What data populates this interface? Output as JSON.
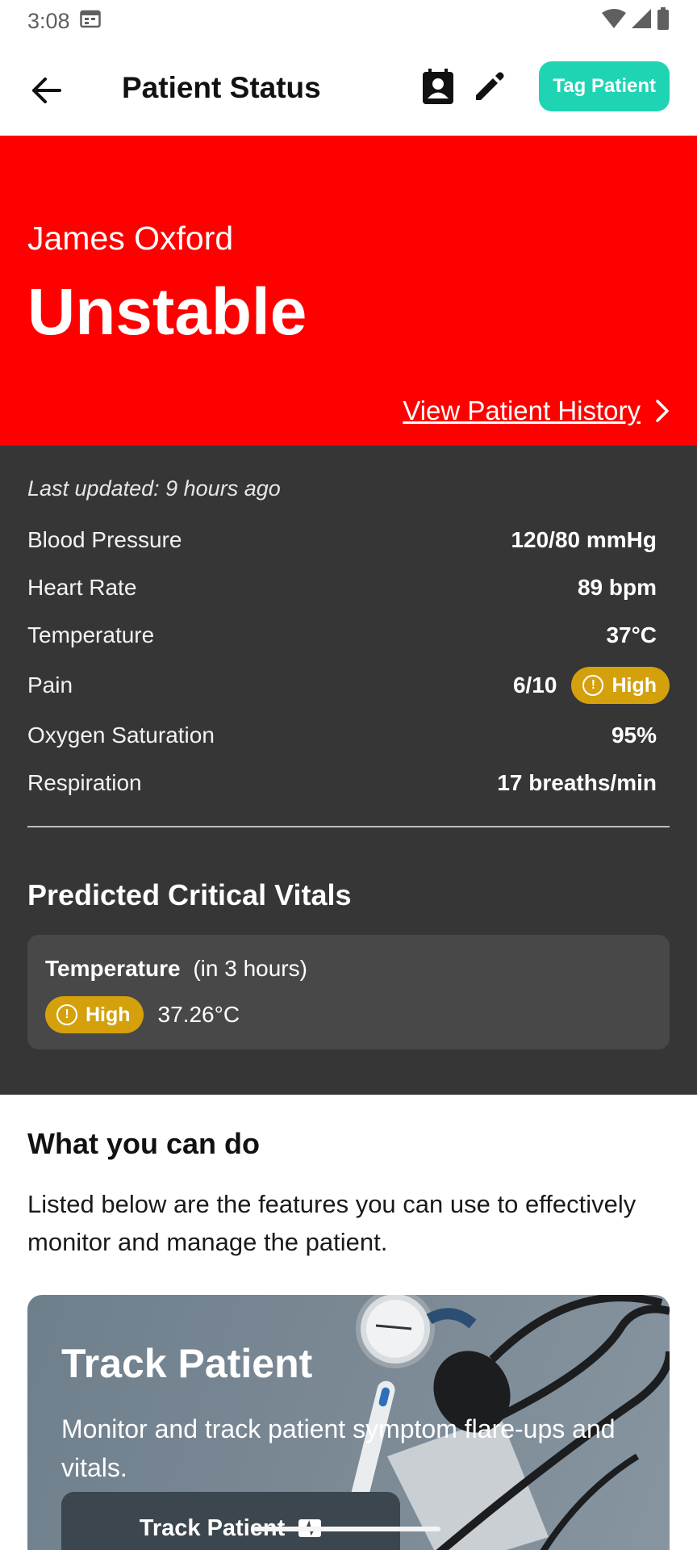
{
  "status_bar": {
    "time": "3:08"
  },
  "app_bar": {
    "title": "Patient Status",
    "tag_button": "Tag Patient"
  },
  "hero": {
    "patient_name": "James Oxford",
    "status": "Unstable",
    "history_link": "View Patient History",
    "background_color": "#ff0000"
  },
  "vitals": {
    "last_updated": "Last updated: 9 hours ago",
    "rows": [
      {
        "label": "Blood Pressure",
        "value": "120/80 mmHg"
      },
      {
        "label": "Heart Rate",
        "value": "89 bpm"
      },
      {
        "label": "Temperature",
        "value": "37°C"
      },
      {
        "label": "Pain",
        "value": "6/10",
        "badge": "High"
      },
      {
        "label": "Oxygen Saturation",
        "value": "95%"
      },
      {
        "label": "Respiration",
        "value": "17 breaths/min"
      }
    ]
  },
  "predicted": {
    "title": "Predicted Critical Vitals",
    "items": [
      {
        "vital": "Temperature",
        "timeframe": "(in 3 hours)",
        "badge": "High",
        "value": "37.26°C"
      }
    ]
  },
  "what_you_can_do": {
    "title": "What you can do",
    "description": "Listed below are the features you can use to effectively monitor and manage the patient."
  },
  "track_card": {
    "title": "Track Patient",
    "description": "Monitor and track patient symptom flare-ups and vitals.",
    "button": "Track Patient"
  },
  "colors": {
    "accent": "#1fd4b3",
    "badge_high": "#d4a10d",
    "panel_dark": "#363636"
  }
}
